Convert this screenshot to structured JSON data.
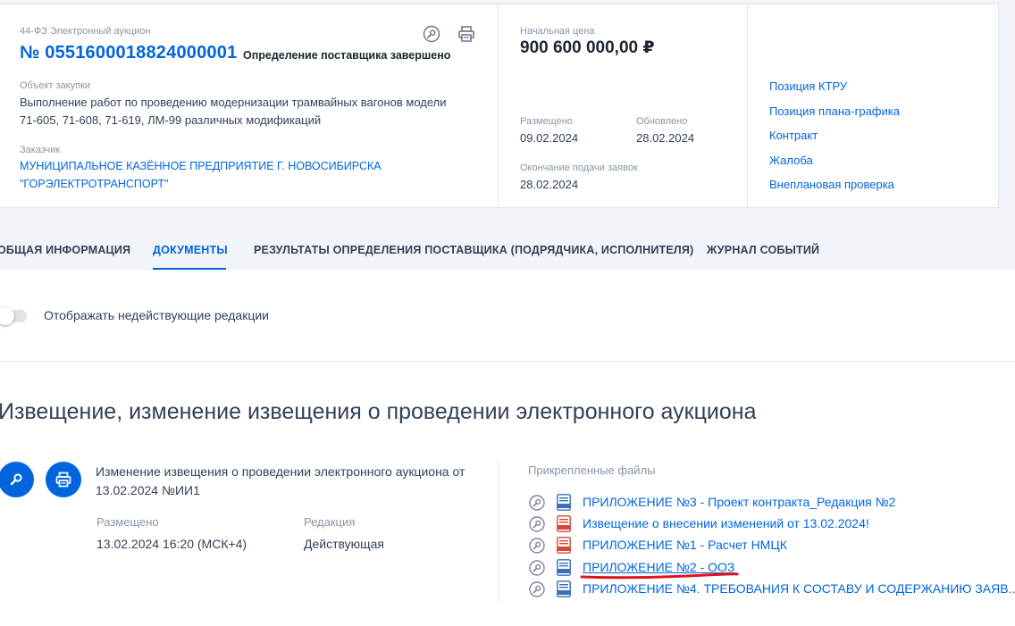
{
  "header": {
    "law_label": "44-ФЗ Электронный аукцион",
    "notice_number": "№ 0551600018824000001",
    "status": "Определение поставщика завершено",
    "object_label": "Объект закупки",
    "object_line1": "Выполнение работ по проведению модернизации трамвайных вагонов модели",
    "object_line2": "71-605, 71-608, 71-619, ЛМ-99 различных модификаций",
    "customer_label": "Заказчик",
    "customer_line1": "МУНИЦИПАЛЬНОЕ КАЗЁННОЕ ПРЕДПРИЯТИЕ Г. НОВОСИБИРСКА",
    "customer_line2": "\"ГОРЭЛЕКТРОТРАНСПОРТ\""
  },
  "price": {
    "label": "Начальная цена",
    "value": "900 600 000,00 ₽"
  },
  "dates": {
    "placed_label": "Размещено",
    "placed_value": "09.02.2024",
    "updated_label": "Обновлено",
    "updated_value": "28.02.2024",
    "deadline_label": "Окончание подачи заявок",
    "deadline_value": "28.02.2024"
  },
  "side_links": [
    "Позиция КТРУ",
    "Позиция плана-графика",
    "Контракт",
    "Жалоба",
    "Внеплановая проверка"
  ],
  "tabs": [
    {
      "label": "ОБЩАЯ ИНФОРМАЦИЯ"
    },
    {
      "label": "ДОКУМЕНТЫ"
    },
    {
      "label": "РЕЗУЛЬТАТЫ ОПРЕДЕЛЕНИЯ ПОСТАВЩИКА (ПОДРЯДЧИКА, ИСПОЛНИТЕЛЯ)"
    },
    {
      "label": "ЖУРНАЛ СОБЫТИЙ"
    }
  ],
  "toggle": {
    "label": "Отображать недействующие редакции",
    "enabled": false
  },
  "section": {
    "title": "Извещение, изменение извещения о проведении электронного аукциона"
  },
  "document": {
    "title": "Изменение извещения о проведении электронного аукциона от 13.02.2024 №ИИ1",
    "placed_label": "Размещено",
    "placed_value": "13.02.2024 16:20 (МСК+4)",
    "edition_label": "Редакция",
    "edition_value": "Действующая",
    "attached_label": "Прикрепленные файлы",
    "files": [
      {
        "name": "ПРИЛОЖЕНИЕ №3 - Проект контракта_Редакция №2",
        "type": "docx"
      },
      {
        "name": "Извещение о внесении изменений от 13.02.2024!",
        "type": "pdf"
      },
      {
        "name": "ПРИЛОЖЕНИЕ №1 - Расчет НМЦК",
        "type": "pdf"
      },
      {
        "name": "ПРИЛОЖЕНИЕ №2 - ООЗ",
        "type": "docx"
      },
      {
        "name": "ПРИЛОЖЕНИЕ №4. ТРЕБОВАНИЯ К СОСТАВУ И СОДЕРЖАНИЮ ЗАЯВ...",
        "type": "docx"
      }
    ]
  },
  "colors": {
    "accent": "#0065dd",
    "text": "#334059",
    "muted": "#8a93a6",
    "pdf": "#d9473b",
    "annotation": "#e0141e"
  }
}
